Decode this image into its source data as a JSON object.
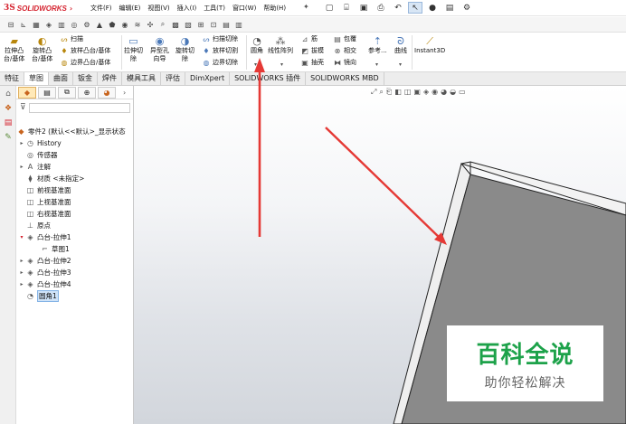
{
  "app": {
    "logo_ds": "3S",
    "logo_text": "SOLIDWORKS"
  },
  "menu": [
    "文件(F)",
    "编辑(E)",
    "视图(V)",
    "插入(I)",
    "工具(T)",
    "窗口(W)",
    "帮助(H)"
  ],
  "ribbon": {
    "extrude_boss": "拉伸凸\n台/基体",
    "revolve_boss": "旋转凸\n台/基体",
    "sweep": "扫描",
    "loft": "放样凸台/基体",
    "boundary_boss": "边界凸台/基体",
    "extrude_cut": "拉伸切\n除",
    "hole_wizard": "异型孔\n向导",
    "revolve_cut": "旋转切\n除",
    "swept_cut": "扫描切除",
    "lofted_cut": "放样切割",
    "boundary_cut": "边界切除",
    "fillet": "圆角",
    "linear_pattern": "线性阵列",
    "rib": "筋",
    "draft": "拔模",
    "shell": "抽壳",
    "wrap": "包覆",
    "intersect": "相交",
    "mirror": "镜向",
    "reference": "参考...",
    "curves": "曲线",
    "instant3d": "Instant3D"
  },
  "tabs": [
    "特征",
    "草图",
    "曲面",
    "钣金",
    "焊件",
    "模具工具",
    "评估",
    "DimXpert",
    "SOLIDWORKS 插件",
    "SOLIDWORKS MBD"
  ],
  "feature_tree": {
    "root": "零件2 (默认<<默认>_显示状态",
    "items": [
      {
        "label": "History",
        "icon": "history-icon",
        "expandable": true
      },
      {
        "label": "传感器",
        "icon": "sensor-icon",
        "expandable": false
      },
      {
        "label": "注解",
        "icon": "annotation-icon",
        "expandable": true
      },
      {
        "label": "材质 <未指定>",
        "icon": "material-icon",
        "expandable": false
      },
      {
        "label": "前视基准面",
        "icon": "plane-icon",
        "expandable": false
      },
      {
        "label": "上视基准面",
        "icon": "plane-icon",
        "expandable": false
      },
      {
        "label": "右视基准面",
        "icon": "plane-icon",
        "expandable": false
      },
      {
        "label": "原点",
        "icon": "origin-icon",
        "expandable": false
      },
      {
        "label": "凸台-拉伸1",
        "icon": "extrude-icon",
        "expandable": true,
        "expanded": true
      },
      {
        "label": "草图1",
        "icon": "sketch-icon",
        "expandable": false,
        "child": true
      },
      {
        "label": "凸台-拉伸2",
        "icon": "extrude-icon",
        "expandable": true
      },
      {
        "label": "凸台-拉伸3",
        "icon": "extrude-icon",
        "expandable": true
      },
      {
        "label": "凸台-拉伸4",
        "icon": "extrude-icon",
        "expandable": true
      },
      {
        "label": "圆角1",
        "icon": "fillet-icon",
        "expandable": false,
        "selected": true
      }
    ]
  },
  "watermark": {
    "title": "百科全说",
    "subtitle": "助你轻松解决"
  },
  "colors": {
    "brand": "#d5232f",
    "arrow": "#e53935",
    "watermark": "#1da24a",
    "part_face": "#8a8a8a"
  }
}
